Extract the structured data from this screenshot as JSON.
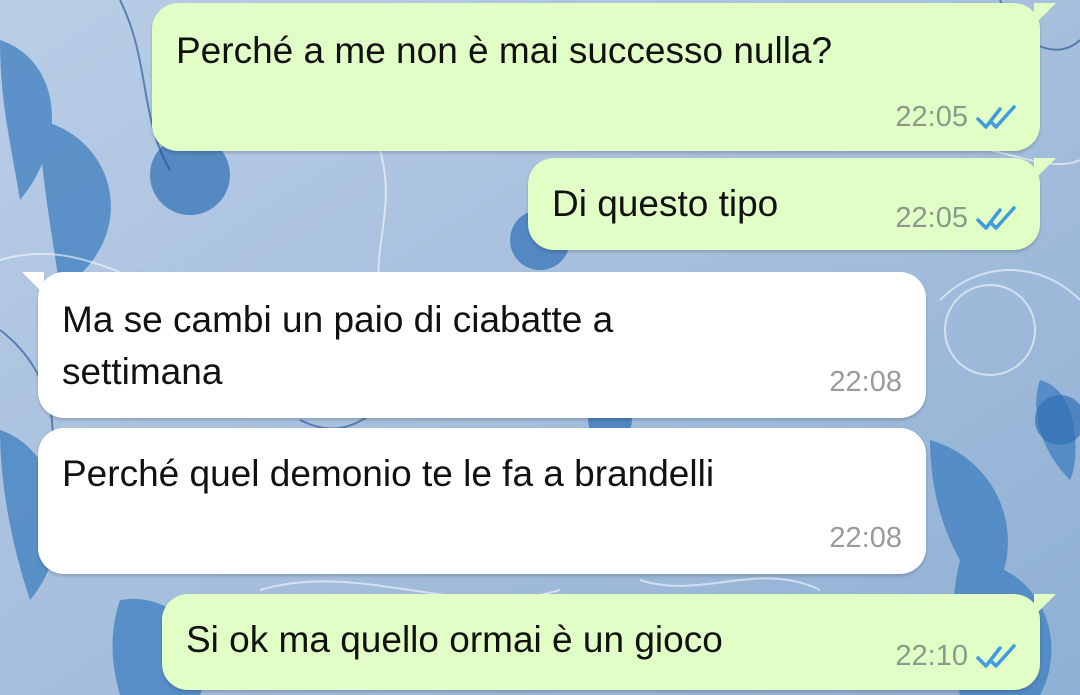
{
  "colors": {
    "outgoing_bubble": "#e1fec6",
    "incoming_bubble": "#ffffff",
    "read_ticks": "#3f9be0",
    "wallpaper": "#9fb8d6"
  },
  "messages": [
    {
      "direction": "outgoing",
      "text": "Perché a me non è mai successo nulla?",
      "time": "22:05",
      "status_icon": "double-check-read-icon"
    },
    {
      "direction": "outgoing",
      "text": "Di questo tipo",
      "time": "22:05",
      "status_icon": "double-check-read-icon"
    },
    {
      "direction": "incoming",
      "text": "Ma se cambi un paio di ciabatte a\nsettimana",
      "time": "22:08"
    },
    {
      "direction": "incoming",
      "text": "Perché quel demonio te le fa a brandelli",
      "time": "22:08"
    },
    {
      "direction": "outgoing",
      "text": "Si ok ma quello ormai è un gioco",
      "time": "22:10",
      "status_icon": "double-check-read-icon"
    }
  ]
}
